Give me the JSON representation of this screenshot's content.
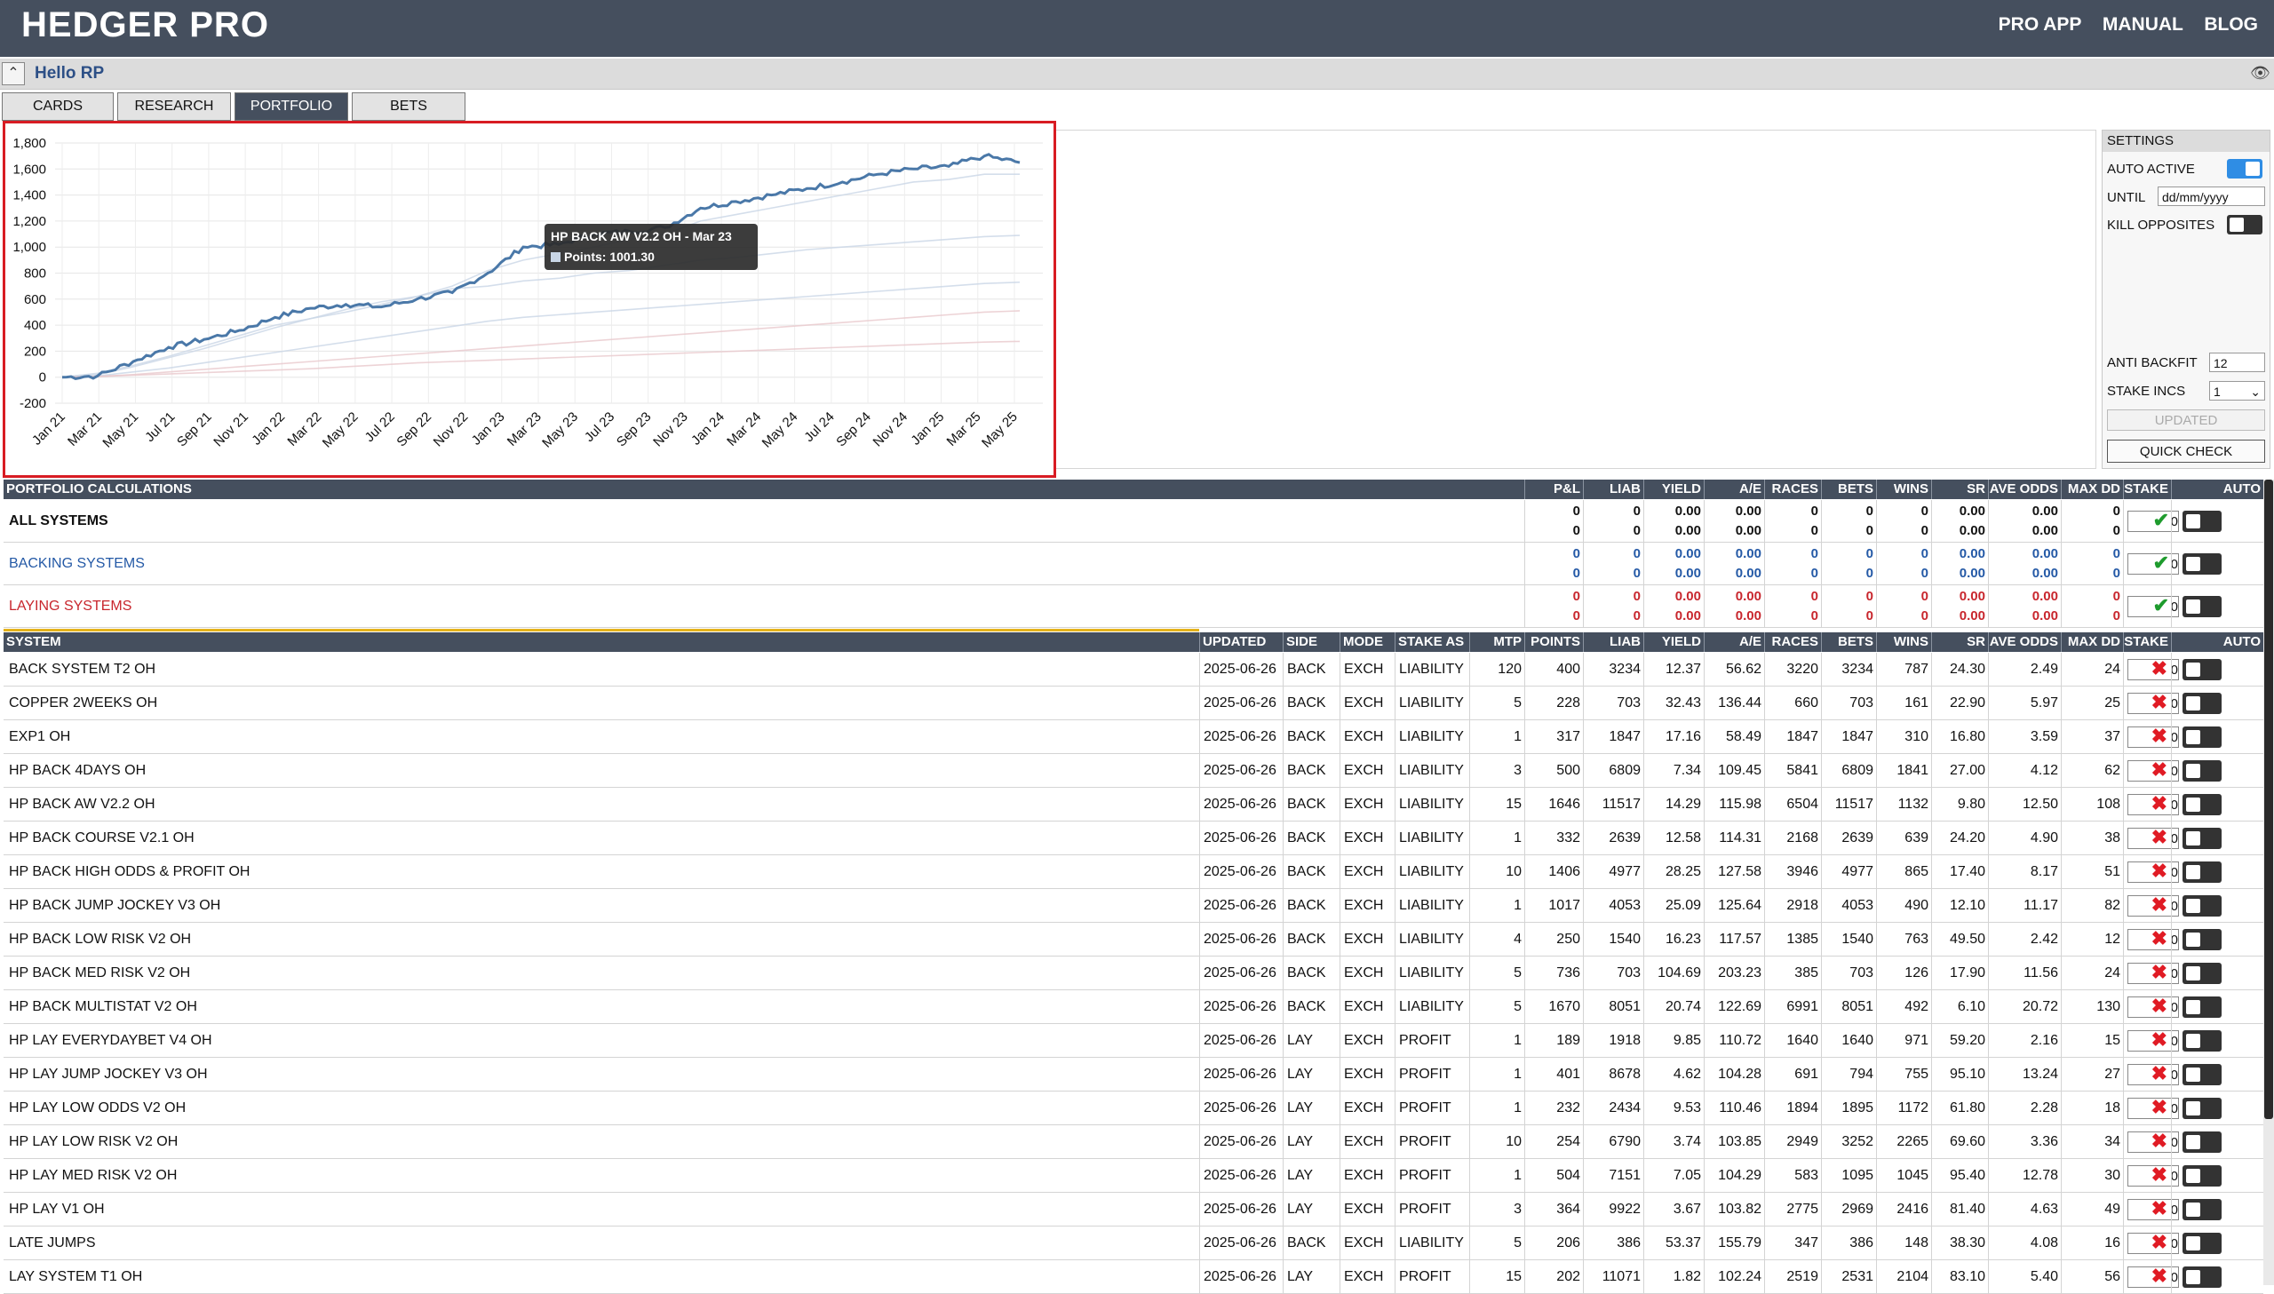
{
  "header": {
    "title": "HEDGER PRO",
    "nav": [
      "PRO APP",
      "MANUAL",
      "BLOG"
    ]
  },
  "hello": "Hello RP",
  "tabs": [
    "CARDS",
    "RESEARCH",
    "PORTFOLIO",
    "BETS"
  ],
  "chart_data": {
    "type": "line",
    "y_ticks": [
      "1,800",
      "1,600",
      "1,400",
      "1,200",
      "1,000",
      "800",
      "600",
      "400",
      "200",
      "0",
      "-200"
    ],
    "ylim": [
      -200,
      1800
    ],
    "x_ticks": [
      "Jan 21",
      "Mar 21",
      "May 21",
      "Jul 21",
      "Sep 21",
      "Nov 21",
      "Jan 22",
      "Mar 22",
      "May 22",
      "Jul 22",
      "Sep 22",
      "Nov 22",
      "Jan 23",
      "Mar 23",
      "May 23",
      "Jul 23",
      "Sep 23",
      "Nov 23",
      "Jan 24",
      "Mar 24",
      "May 24",
      "Jul 24",
      "Sep 24",
      "Nov 24",
      "Jan 25",
      "Mar 25",
      "May 25"
    ],
    "grid": true,
    "highlighted_series": {
      "x": [
        "Jan 21",
        "Mar 21",
        "May 21",
        "Jul 21",
        "Sep 21",
        "Nov 21",
        "Jan 22",
        "Mar 22",
        "May 22",
        "Jul 22",
        "Sep 22",
        "Nov 22",
        "Jan 23",
        "Mar 23",
        "May 23",
        "Jul 23",
        "Sep 23",
        "Nov 23",
        "Jan 24",
        "Mar 24",
        "May 24",
        "Jul 24",
        "Sep 24",
        "Nov 24",
        "Jan 25",
        "Mar 25",
        "May 25",
        "Jun 25"
      ],
      "values": [
        0,
        10,
        120,
        230,
        290,
        360,
        460,
        530,
        560,
        540,
        600,
        650,
        800,
        1001,
        1020,
        1100,
        1120,
        1150,
        1300,
        1350,
        1400,
        1450,
        1500,
        1560,
        1600,
        1620,
        1700,
        1650
      ]
    },
    "faint_series": [
      {
        "values": [
          0,
          20,
          80,
          150,
          220,
          300,
          380,
          450,
          500,
          560,
          620,
          700,
          820,
          900,
          950,
          1000,
          1060,
          1100,
          1200,
          1250,
          1300,
          1350,
          1400,
          1450,
          1500,
          1520,
          1560,
          1560
        ]
      },
      {
        "values": [
          0,
          30,
          90,
          160,
          240,
          320,
          400,
          450,
          520,
          580,
          620,
          680,
          700,
          740,
          760,
          800,
          820,
          860,
          900,
          920,
          950,
          980,
          1000,
          1020,
          1040,
          1060,
          1080,
          1090
        ]
      },
      {
        "values": [
          0,
          10,
          40,
          70,
          110,
          150,
          190,
          230,
          270,
          310,
          350,
          390,
          430,
          460,
          480,
          500,
          520,
          540,
          560,
          580,
          600,
          620,
          640,
          660,
          680,
          700,
          720,
          730
        ]
      },
      {
        "values": [
          0,
          5,
          20,
          40,
          60,
          80,
          100,
          120,
          140,
          160,
          180,
          200,
          220,
          240,
          260,
          280,
          300,
          320,
          340,
          360,
          380,
          400,
          420,
          440,
          460,
          480,
          500,
          510
        ]
      },
      {
        "values": [
          0,
          5,
          15,
          25,
          35,
          45,
          55,
          65,
          80,
          95,
          110,
          120,
          130,
          140,
          150,
          160,
          170,
          180,
          190,
          200,
          210,
          220,
          230,
          240,
          250,
          260,
          270,
          275
        ]
      }
    ],
    "tooltip": {
      "title": "HP BACK AW V2.2 OH - Mar 23",
      "label": "Points: 1001.30"
    },
    "colors": {
      "main": "#4a78a8",
      "faint": "#c9d6e6",
      "faint_red": "#e8c8cc"
    }
  },
  "settings": {
    "title": "SETTINGS",
    "auto_active": "AUTO ACTIVE",
    "until": "UNTIL",
    "until_placeholder": "dd/mm/yyyy",
    "kill_opposites": "KILL OPPOSITES",
    "anti_backfit": "ANTI BACKFIT",
    "anti_backfit_value": "12",
    "stake_incs": "STAKE INCS",
    "stake_incs_value": "1",
    "updated": "UPDATED",
    "quick_check": "QUICK CHECK"
  },
  "portfolio": {
    "title": "PORTFOLIO CALCULATIONS",
    "columns": [
      "P&L",
      "LIAB",
      "YIELD",
      "A/E",
      "RACES",
      "BETS",
      "WINS",
      "SR",
      "AVE ODDS",
      "MAX DD",
      "STAKE",
      "AUTO"
    ],
    "rows": [
      {
        "name": "ALL SYSTEMS",
        "color": "#111111",
        "line1": [
          "0",
          "0",
          "0.00",
          "0.00",
          "0",
          "0",
          "0",
          "0.00",
          "0.00",
          "0"
        ],
        "line2": [
          "0",
          "0",
          "0.00",
          "0.00",
          "0",
          "0",
          "0",
          "0.00",
          "0.00",
          "0"
        ],
        "stake": "0"
      },
      {
        "name": "BACKING SYSTEMS",
        "color": "#2459a6",
        "line1": [
          "0",
          "0",
          "0.00",
          "0.00",
          "0",
          "0",
          "0",
          "0.00",
          "0.00",
          "0"
        ],
        "line2": [
          "0",
          "0",
          "0.00",
          "0.00",
          "0",
          "0",
          "0",
          "0.00",
          "0.00",
          "0"
        ],
        "stake": "0"
      },
      {
        "name": "LAYING SYSTEMS",
        "color": "#c8262d",
        "line1": [
          "0",
          "0",
          "0.00",
          "0.00",
          "0",
          "0",
          "0",
          "0.00",
          "0.00",
          "0"
        ],
        "line2": [
          "0",
          "0",
          "0.00",
          "0.00",
          "0",
          "0",
          "0",
          "0.00",
          "0.00",
          "0"
        ],
        "stake": "0"
      }
    ]
  },
  "systems": {
    "columns": [
      "SYSTEM",
      "UPDATED",
      "SIDE",
      "MODE",
      "STAKE AS",
      "MTP",
      "POINTS",
      "LIAB",
      "YIELD",
      "A/E",
      "RACES",
      "BETS",
      "WINS",
      "SR",
      "AVE ODDS",
      "MAX DD",
      "STAKE",
      "AUTO"
    ],
    "rows": [
      [
        "BACK SYSTEM T2 OH",
        "2025-06-26",
        "BACK",
        "EXCH",
        "LIABILITY",
        "120",
        "400",
        "3234",
        "12.37",
        "56.62",
        "3220",
        "3234",
        "787",
        "24.30",
        "2.49",
        "24",
        "0"
      ],
      [
        "COPPER 2WEEKS OH",
        "2025-06-26",
        "BACK",
        "EXCH",
        "LIABILITY",
        "5",
        "228",
        "703",
        "32.43",
        "136.44",
        "660",
        "703",
        "161",
        "22.90",
        "5.97",
        "25",
        "0"
      ],
      [
        "EXP1 OH",
        "2025-06-26",
        "BACK",
        "EXCH",
        "LIABILITY",
        "1",
        "317",
        "1847",
        "17.16",
        "58.49",
        "1847",
        "1847",
        "310",
        "16.80",
        "3.59",
        "37",
        "0"
      ],
      [
        "HP BACK 4DAYS OH",
        "2025-06-26",
        "BACK",
        "EXCH",
        "LIABILITY",
        "3",
        "500",
        "6809",
        "7.34",
        "109.45",
        "5841",
        "6809",
        "1841",
        "27.00",
        "4.12",
        "62",
        "0"
      ],
      [
        "HP BACK AW V2.2 OH",
        "2025-06-26",
        "BACK",
        "EXCH",
        "LIABILITY",
        "15",
        "1646",
        "11517",
        "14.29",
        "115.98",
        "6504",
        "11517",
        "1132",
        "9.80",
        "12.50",
        "108",
        "0"
      ],
      [
        "HP BACK COURSE V2.1 OH",
        "2025-06-26",
        "BACK",
        "EXCH",
        "LIABILITY",
        "1",
        "332",
        "2639",
        "12.58",
        "114.31",
        "2168",
        "2639",
        "639",
        "24.20",
        "4.90",
        "38",
        "0"
      ],
      [
        "HP BACK HIGH ODDS & PROFIT OH",
        "2025-06-26",
        "BACK",
        "EXCH",
        "LIABILITY",
        "10",
        "1406",
        "4977",
        "28.25",
        "127.58",
        "3946",
        "4977",
        "865",
        "17.40",
        "8.17",
        "51",
        "0"
      ],
      [
        "HP BACK JUMP JOCKEY V3 OH",
        "2025-06-26",
        "BACK",
        "EXCH",
        "LIABILITY",
        "1",
        "1017",
        "4053",
        "25.09",
        "125.64",
        "2918",
        "4053",
        "490",
        "12.10",
        "11.17",
        "82",
        "0"
      ],
      [
        "HP BACK LOW RISK V2 OH",
        "2025-06-26",
        "BACK",
        "EXCH",
        "LIABILITY",
        "4",
        "250",
        "1540",
        "16.23",
        "117.57",
        "1385",
        "1540",
        "763",
        "49.50",
        "2.42",
        "12",
        "0"
      ],
      [
        "HP BACK MED RISK V2 OH",
        "2025-06-26",
        "BACK",
        "EXCH",
        "LIABILITY",
        "5",
        "736",
        "703",
        "104.69",
        "203.23",
        "385",
        "703",
        "126",
        "17.90",
        "11.56",
        "24",
        "0"
      ],
      [
        "HP BACK MULTISTAT V2 OH",
        "2025-06-26",
        "BACK",
        "EXCH",
        "LIABILITY",
        "5",
        "1670",
        "8051",
        "20.74",
        "122.69",
        "6991",
        "8051",
        "492",
        "6.10",
        "20.72",
        "130",
        "0"
      ],
      [
        "HP LAY EVERYDAYBET V4 OH",
        "2025-06-26",
        "LAY",
        "EXCH",
        "PROFIT",
        "1",
        "189",
        "1918",
        "9.85",
        "110.72",
        "1640",
        "1640",
        "971",
        "59.20",
        "2.16",
        "15",
        "0"
      ],
      [
        "HP LAY JUMP JOCKEY V3 OH",
        "2025-06-26",
        "LAY",
        "EXCH",
        "PROFIT",
        "1",
        "401",
        "8678",
        "4.62",
        "104.28",
        "691",
        "794",
        "755",
        "95.10",
        "13.24",
        "27",
        "0"
      ],
      [
        "HP LAY LOW ODDS V2 OH",
        "2025-06-26",
        "LAY",
        "EXCH",
        "PROFIT",
        "1",
        "232",
        "2434",
        "9.53",
        "110.46",
        "1894",
        "1895",
        "1172",
        "61.80",
        "2.28",
        "18",
        "0"
      ],
      [
        "HP LAY LOW RISK V2 OH",
        "2025-06-26",
        "LAY",
        "EXCH",
        "PROFIT",
        "10",
        "254",
        "6790",
        "3.74",
        "103.85",
        "2949",
        "3252",
        "2265",
        "69.60",
        "3.36",
        "34",
        "0"
      ],
      [
        "HP LAY MED RISK V2 OH",
        "2025-06-26",
        "LAY",
        "EXCH",
        "PROFIT",
        "1",
        "504",
        "7151",
        "7.05",
        "104.29",
        "583",
        "1095",
        "1045",
        "95.40",
        "12.78",
        "30",
        "0"
      ],
      [
        "HP LAY V1 OH",
        "2025-06-26",
        "LAY",
        "EXCH",
        "PROFIT",
        "3",
        "364",
        "9922",
        "3.67",
        "103.82",
        "2775",
        "2969",
        "2416",
        "81.40",
        "4.63",
        "49",
        "0"
      ],
      [
        "LATE JUMPS",
        "2025-06-26",
        "BACK",
        "EXCH",
        "LIABILITY",
        "5",
        "206",
        "386",
        "53.37",
        "155.79",
        "347",
        "386",
        "148",
        "38.30",
        "4.08",
        "16",
        "0"
      ],
      [
        "LAY SYSTEM T1 OH",
        "2025-06-26",
        "LAY",
        "EXCH",
        "PROFIT",
        "15",
        "202",
        "11071",
        "1.82",
        "102.24",
        "2519",
        "2531",
        "2104",
        "83.10",
        "5.40",
        "56",
        "0"
      ]
    ]
  }
}
